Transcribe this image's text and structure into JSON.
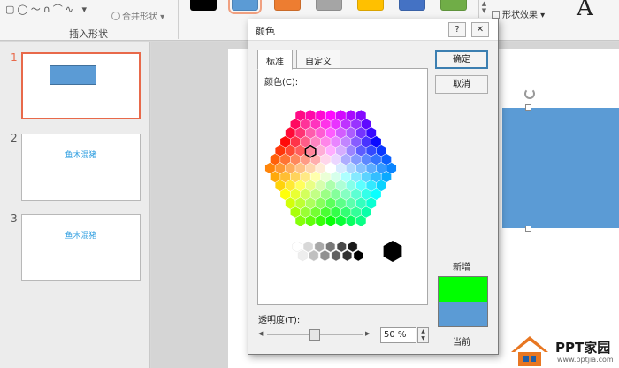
{
  "ribbon": {
    "merge_shapes": "合并形状",
    "group_insert_shapes": "插入形状",
    "shape_effects": "形状效果",
    "style_sample": "A",
    "swatches": [
      "#000000",
      "#5b9bd5",
      "#ed7d31",
      "#a5a5a5",
      "#ffc000",
      "#4472c4",
      "#70ad47"
    ]
  },
  "slides": [
    {
      "number": "1",
      "text": ""
    },
    {
      "number": "2",
      "text": "鱼木混猪"
    },
    {
      "number": "3",
      "text": "鱼木混猪"
    }
  ],
  "dialog": {
    "title": "颜色",
    "help": "?",
    "close": "✕",
    "tabs": [
      "标准",
      "自定义"
    ],
    "colors_label": "颜色(C):",
    "ok": "确定",
    "cancel": "取消",
    "new_label": "新增",
    "current_label": "当前",
    "new_color": "#00ff00",
    "current_color": "#5b9bd5",
    "transparency_label": "透明度(T):",
    "transparency_value": "50 %",
    "transparency_fraction": 0.5
  },
  "logo": {
    "text": "PPT家园",
    "sub": "www.pptjia.com"
  }
}
